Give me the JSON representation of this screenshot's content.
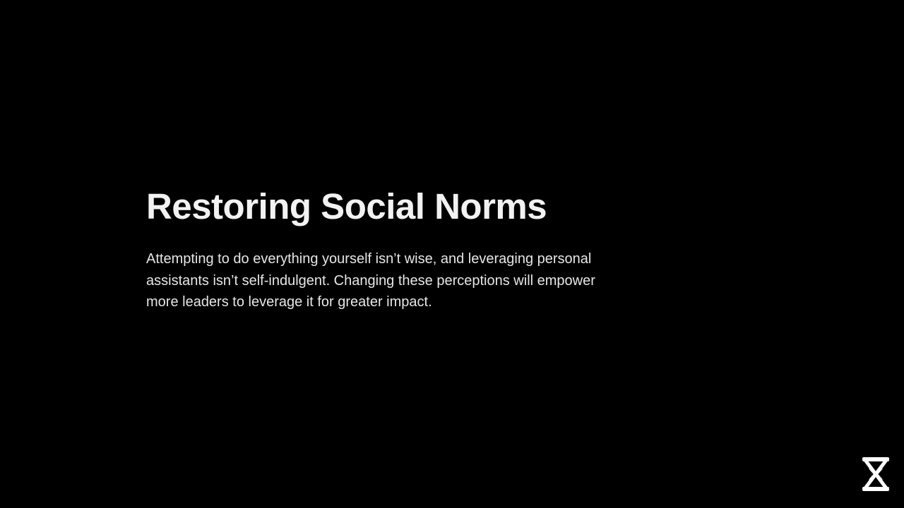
{
  "slide": {
    "title": "Restoring Social Norms",
    "body": "Attempting to do everything yourself isn’t wise, and leveraging personal assistants isn’t self-indulgent. Changing these perceptions will empower more leaders to leverage it for greater impact."
  },
  "logo": {
    "icon": "hourglass-logo-icon",
    "color": "#ffffff"
  },
  "colors": {
    "background": "#000000",
    "title": "#f2f2f2",
    "body": "#e6e6e6"
  }
}
